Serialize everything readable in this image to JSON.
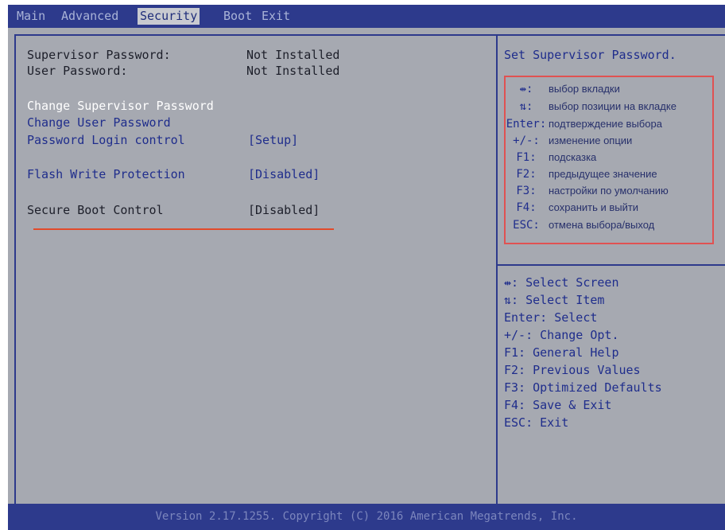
{
  "tabs": [
    {
      "label": "Main"
    },
    {
      "label": "Advanced"
    },
    {
      "label": "Security"
    },
    {
      "label": "Boot"
    },
    {
      "label": "Exit"
    }
  ],
  "settings": {
    "supervisor_password": {
      "label": "Supervisor Password:",
      "value": "Not Installed"
    },
    "user_password": {
      "label": "User Password:",
      "value": "Not Installed"
    },
    "change_supervisor": {
      "label": "Change Supervisor Password"
    },
    "change_user": {
      "label": "Change User Password"
    },
    "password_login": {
      "label": "Password Login control",
      "value": "[Setup]"
    },
    "flash_write": {
      "label": "Flash Write Protection",
      "value": "[Disabled]"
    },
    "secure_boot": {
      "label": "Secure Boot Control",
      "value": "[Disabled]"
    }
  },
  "help": {
    "title": "Set Supervisor Password."
  },
  "legend_ru": [
    {
      "key": "⇹:",
      "text": "выбор вкладки"
    },
    {
      "key": "⇅:",
      "text": "выбор позиции на вкладке"
    },
    {
      "key": "Enter:",
      "text": "подтверждение выбора"
    },
    {
      "key": "+/-:",
      "text": "изменение опции"
    },
    {
      "key": "F1:",
      "text": "подсказка"
    },
    {
      "key": "F2:",
      "text": "предыдущее значение"
    },
    {
      "key": "F3:",
      "text": "настройки по умолчанию"
    },
    {
      "key": "F4:",
      "text": "сохранить и выйти"
    },
    {
      "key": "ESC:",
      "text": "отмена выбора/выход"
    }
  ],
  "keys_en": [
    "⇹: Select Screen",
    "⇅: Select Item",
    "Enter: Select",
    "+/-: Change Opt.",
    "F1: General Help",
    "F2: Previous Values",
    "F3: Optimized Defaults",
    "F4: Save & Exit",
    "ESC: Exit"
  ],
  "footer": "Version 2.17.1255. Copyright (C) 2016 American Megatrends, Inc.",
  "colors": {
    "accent": "#2d3a8c",
    "panel": "#a6a9b1",
    "highlight": "#e14a2a"
  }
}
